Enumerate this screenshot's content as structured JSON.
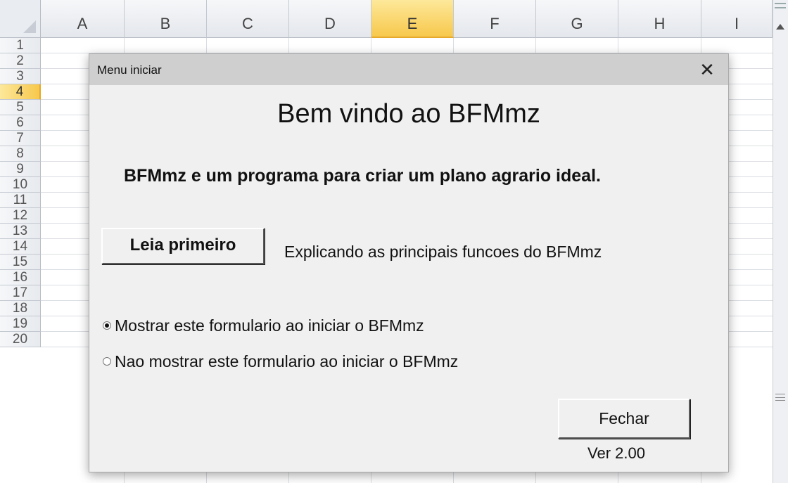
{
  "sheet": {
    "columns": [
      "A",
      "B",
      "C",
      "D",
      "E",
      "F",
      "G",
      "H",
      "I"
    ],
    "selected_column": "E",
    "rows": [
      "1",
      "2",
      "3",
      "4",
      "5",
      "6",
      "7",
      "8",
      "9",
      "10",
      "11",
      "12",
      "13",
      "14",
      "15",
      "16",
      "17",
      "18",
      "19",
      "20"
    ],
    "selected_row": "4"
  },
  "dialog": {
    "title": "Menu iniciar",
    "close_glyph": "✕",
    "welcome": "Bem vindo ao BFMmz",
    "description": "BFMmz e um programa para criar um plano agrario ideal.",
    "read_first_button": "Leia primeiro",
    "read_first_description": "Explicando as principais funcoes do BFMmz",
    "radio_options": [
      {
        "label": "Mostrar este formulario ao iniciar o BFMmz",
        "selected": true
      },
      {
        "label": "Nao mostrar este formulario ao iniciar o BFMmz",
        "selected": false
      }
    ],
    "close_button": "Fechar",
    "version": "Ver 2.00"
  }
}
